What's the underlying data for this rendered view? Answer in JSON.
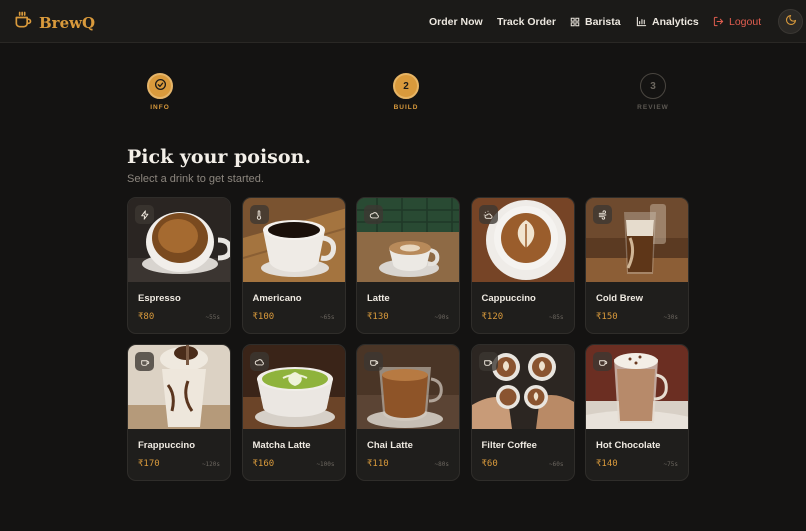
{
  "brand": {
    "name": "BrewQ"
  },
  "nav": {
    "order_now": "Order Now",
    "track_order": "Track Order",
    "barista": "Barista",
    "analytics": "Analytics",
    "logout": "Logout"
  },
  "stepper": [
    {
      "number": "1",
      "label": "INFO",
      "state": "done"
    },
    {
      "number": "2",
      "label": "BUILD",
      "state": "active"
    },
    {
      "number": "3",
      "label": "REVIEW",
      "state": "pending"
    }
  ],
  "heading": {
    "title": "Pick your poison.",
    "subtitle": "Select a drink to get started."
  },
  "drinks": [
    {
      "name": "Espresso",
      "price": "₹80",
      "time": "~55s",
      "icon": "bolt-icon"
    },
    {
      "name": "Americano",
      "price": "₹100",
      "time": "~65s",
      "icon": "thermometer-icon"
    },
    {
      "name": "Latte",
      "price": "₹130",
      "time": "~90s",
      "icon": "cloud-icon"
    },
    {
      "name": "Cappuccino",
      "price": "₹120",
      "time": "~85s",
      "icon": "cloud-sun-icon"
    },
    {
      "name": "Cold Brew",
      "price": "₹150",
      "time": "~30s",
      "icon": "wind-icon"
    },
    {
      "name": "Frappuccino",
      "price": "₹170",
      "time": "~120s",
      "icon": "cup-icon"
    },
    {
      "name": "Matcha Latte",
      "price": "₹160",
      "time": "~100s",
      "icon": "cloud-icon"
    },
    {
      "name": "Chai Latte",
      "price": "₹110",
      "time": "~80s",
      "icon": "cup-icon"
    },
    {
      "name": "Filter Coffee",
      "price": "₹60",
      "time": "~60s",
      "icon": "cup-icon"
    },
    {
      "name": "Hot Chocolate",
      "price": "₹140",
      "time": "~75s",
      "icon": "cup-icon"
    }
  ],
  "colors": {
    "accent": "#d99a3c",
    "logout": "#e05d4f",
    "background": "#141312"
  }
}
